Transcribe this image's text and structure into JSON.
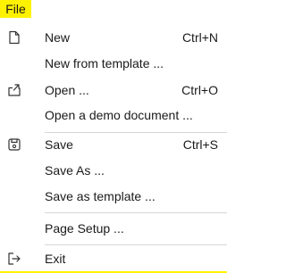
{
  "menu_title": "File",
  "accent_color": "#fff200",
  "items": [
    {
      "label": "New",
      "shortcut": "Ctrl+N",
      "icon": "new-document-icon"
    },
    {
      "label": "New from template ...",
      "shortcut": ""
    },
    {
      "label": "Open ...",
      "shortcut": "Ctrl+O",
      "icon": "open-folder-icon"
    },
    {
      "label": "Open a demo document ...",
      "shortcut": ""
    },
    {
      "label": "Save",
      "shortcut": "Ctrl+S",
      "icon": "save-icon"
    },
    {
      "label": "Save As ...",
      "shortcut": ""
    },
    {
      "label": "Save as template ...",
      "shortcut": ""
    },
    {
      "label": "Page Setup ...",
      "shortcut": ""
    },
    {
      "label": "Exit",
      "shortcut": "",
      "icon": "exit-icon"
    }
  ]
}
